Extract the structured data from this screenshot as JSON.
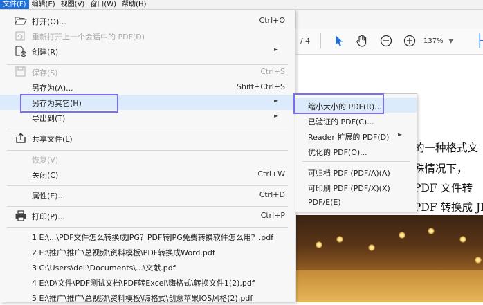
{
  "menubar": [
    "文件(F)",
    "编辑(E)",
    "视图(V)",
    "窗口(W)",
    "帮助(H)"
  ],
  "toolbar": {
    "page_total": "/ 4",
    "zoom": "137%"
  },
  "document_lines": [
    "的一种格式文",
    "殊情况下，",
    "PDF 文件转",
    "PDF 转换成 JPG"
  ],
  "file_menu": {
    "open": {
      "label": "打开(O)...",
      "shortcut": "Ctrl+O"
    },
    "reopen": {
      "label": "重新打开上一个会话中的 PDF(D)"
    },
    "create": {
      "label": "创建(R)"
    },
    "save": {
      "label": "保存(S)",
      "shortcut": "Ctrl+S"
    },
    "save_as": {
      "label": "另存为(A)...",
      "shortcut": "Shift+Ctrl+S"
    },
    "save_as_other": {
      "label": "另存为其它(H)"
    },
    "export_to": {
      "label": "导出到(T)"
    },
    "share": {
      "label": "共享文件(L)"
    },
    "revert": {
      "label": "恢复(V)"
    },
    "close": {
      "label": "关闭(C)",
      "shortcut": "Ctrl+W"
    },
    "properties": {
      "label": "属性(E)...",
      "shortcut": "Ctrl+D"
    },
    "print": {
      "label": "打印(P)...",
      "shortcut": "Ctrl+P"
    },
    "recent": [
      "1 E:\\...\\PDF文件怎么转换成JPG？PDF转JPG免费转换软件怎么用？.pdf",
      "2 E:\\推广\\推广\\总视频\\资料模板\\PDF转换成Word.pdf",
      "3 C:\\Users\\dell\\Documents\\...\\文献.pdf",
      "4 E:\\D\\文件\\PDF测试文档\\PDF转Excel\\嗨格式\\转换文件1(2).pdf",
      "5 E:\\推广\\推广\\总视频\\资料模板\\嗨格式\\创意苹果IOS风格(2).pdf"
    ]
  },
  "submenu": {
    "reduced_size": "缩小大小的 PDF(R)...",
    "certified": "已验证的 PDF(C)...",
    "reader_extended": "Reader 扩展的 PDF(D)",
    "optimized": "优化的 PDF(O)...",
    "archivable": "可归档 PDF (PDF/A)(A)",
    "printable": "可印刷 PDF (PDF/X)(X)",
    "pdfe": "PDF/E(E)"
  },
  "colors": {
    "accent": "#1f6fd6",
    "highlight": "#dcebfb",
    "outline": "#7b6ef0"
  }
}
